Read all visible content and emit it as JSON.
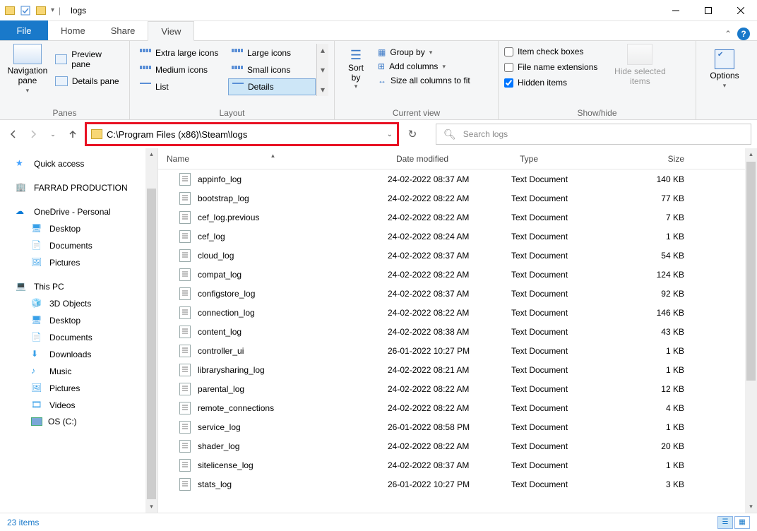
{
  "titlebar": {
    "title": "logs"
  },
  "menutabs": {
    "file": "File",
    "home": "Home",
    "share": "Share",
    "view": "View"
  },
  "ribbon": {
    "panes": {
      "nav": "Navigation\npane",
      "preview": "Preview pane",
      "details": "Details pane",
      "label": "Panes"
    },
    "layout": {
      "xl": "Extra large icons",
      "l": "Large icons",
      "m": "Medium icons",
      "s": "Small icons",
      "list": "List",
      "det": "Details",
      "label": "Layout"
    },
    "curview": {
      "sort": "Sort\nby",
      "group": "Group by",
      "addcol": "Add columns",
      "sizeall": "Size all columns to fit",
      "label": "Current view"
    },
    "showhide": {
      "chk1": "Item check boxes",
      "chk2": "File name extensions",
      "chk3": "Hidden items",
      "hide": "Hide selected\nitems",
      "label": "Show/hide"
    },
    "options": {
      "opt": "Options"
    }
  },
  "address": "C:\\Program Files (x86)\\Steam\\logs",
  "search_placeholder": "Search logs",
  "sidebar": {
    "quick": "Quick access",
    "farrad": "FARRAD PRODUCTION",
    "onedrive": "OneDrive - Personal",
    "od_desktop": "Desktop",
    "od_documents": "Documents",
    "od_pictures": "Pictures",
    "thispc": "This PC",
    "pc_3d": "3D Objects",
    "pc_desktop": "Desktop",
    "pc_documents": "Documents",
    "pc_downloads": "Downloads",
    "pc_music": "Music",
    "pc_pictures": "Pictures",
    "pc_videos": "Videos",
    "pc_c": "OS (C:)"
  },
  "columns": {
    "name": "Name",
    "date": "Date modified",
    "type": "Type",
    "size": "Size"
  },
  "files": [
    {
      "n": "appinfo_log",
      "d": "24-02-2022 08:37 AM",
      "t": "Text Document",
      "s": "140 KB"
    },
    {
      "n": "bootstrap_log",
      "d": "24-02-2022 08:22 AM",
      "t": "Text Document",
      "s": "77 KB"
    },
    {
      "n": "cef_log.previous",
      "d": "24-02-2022 08:22 AM",
      "t": "Text Document",
      "s": "7 KB"
    },
    {
      "n": "cef_log",
      "d": "24-02-2022 08:24 AM",
      "t": "Text Document",
      "s": "1 KB"
    },
    {
      "n": "cloud_log",
      "d": "24-02-2022 08:37 AM",
      "t": "Text Document",
      "s": "54 KB"
    },
    {
      "n": "compat_log",
      "d": "24-02-2022 08:22 AM",
      "t": "Text Document",
      "s": "124 KB"
    },
    {
      "n": "configstore_log",
      "d": "24-02-2022 08:37 AM",
      "t": "Text Document",
      "s": "92 KB"
    },
    {
      "n": "connection_log",
      "d": "24-02-2022 08:22 AM",
      "t": "Text Document",
      "s": "146 KB"
    },
    {
      "n": "content_log",
      "d": "24-02-2022 08:38 AM",
      "t": "Text Document",
      "s": "43 KB"
    },
    {
      "n": "controller_ui",
      "d": "26-01-2022 10:27 PM",
      "t": "Text Document",
      "s": "1 KB"
    },
    {
      "n": "librarysharing_log",
      "d": "24-02-2022 08:21 AM",
      "t": "Text Document",
      "s": "1 KB"
    },
    {
      "n": "parental_log",
      "d": "24-02-2022 08:22 AM",
      "t": "Text Document",
      "s": "12 KB"
    },
    {
      "n": "remote_connections",
      "d": "24-02-2022 08:22 AM",
      "t": "Text Document",
      "s": "4 KB"
    },
    {
      "n": "service_log",
      "d": "26-01-2022 08:58 PM",
      "t": "Text Document",
      "s": "1 KB"
    },
    {
      "n": "shader_log",
      "d": "24-02-2022 08:22 AM",
      "t": "Text Document",
      "s": "20 KB"
    },
    {
      "n": "sitelicense_log",
      "d": "24-02-2022 08:37 AM",
      "t": "Text Document",
      "s": "1 KB"
    },
    {
      "n": "stats_log",
      "d": "26-01-2022 10:27 PM",
      "t": "Text Document",
      "s": "3 KB"
    }
  ],
  "status": {
    "count": "23 items"
  }
}
